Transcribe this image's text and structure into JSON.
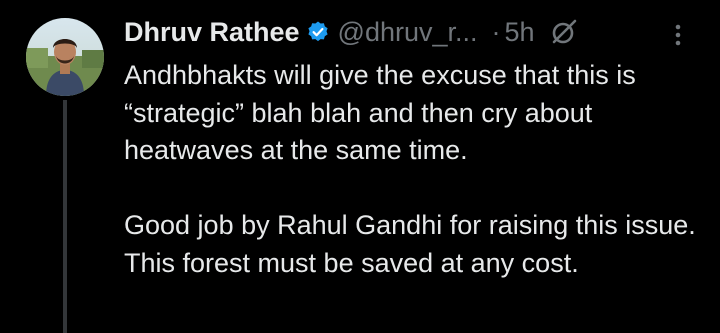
{
  "tweet": {
    "author": {
      "name": "Dhruv Rathee",
      "handle": "@dhruv_r...",
      "avatar_icon": "profile-photo",
      "verified_icon": "verified-badge-icon"
    },
    "separator": "·",
    "timestamp": "5h",
    "paragraphs": [
      "Andhbhakts will give the excuse that this is “strategic” blah blah and then cry about heatwaves at the same time.",
      "Good job by Rahul Gandhi for raising this issue. This forest must be saved at any cost."
    ]
  },
  "colors": {
    "background": "#000000",
    "text": "#e7e9ea",
    "secondary": "#71767b",
    "verified": "#1d9bf0",
    "thread_line": "#333639"
  }
}
